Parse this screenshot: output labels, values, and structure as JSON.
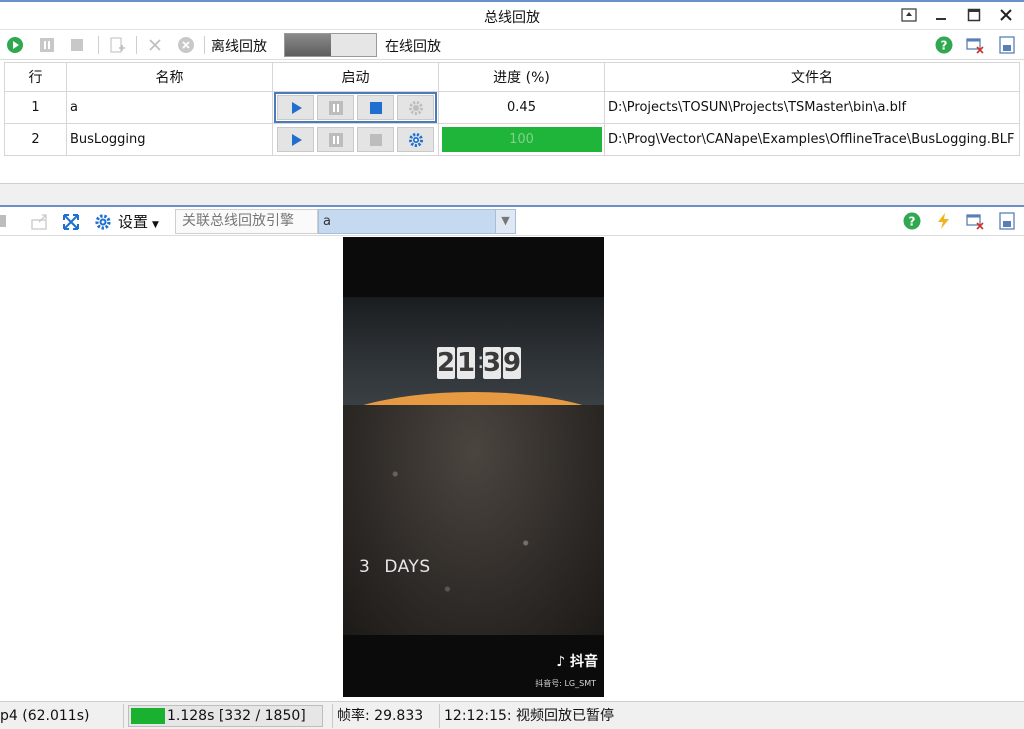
{
  "window": {
    "title": "总线回放"
  },
  "toolbar1": {
    "offline_label": "离线回放",
    "online_label": "在线回放",
    "icons": [
      "play-icon",
      "pause-icon",
      "stop-icon",
      "add-icon",
      "delete-icon",
      "clear-icon",
      "help-icon",
      "close-window-icon",
      "export-icon"
    ]
  },
  "table": {
    "headers": {
      "row": "行",
      "name": "名称",
      "start": "启动",
      "progress": "进度 (%)",
      "file": "文件名"
    },
    "rows": [
      {
        "row": "1",
        "name": "a",
        "progress": "0.45",
        "progress_fraction": 0.0045,
        "file": "D:\\Projects\\TOSUN\\Projects\\TSMaster\\bin\\a.blf",
        "stop_active": true
      },
      {
        "row": "2",
        "name": "BusLogging",
        "progress": "100",
        "progress_fraction": 1.0,
        "file": "D:\\Prog\\Vector\\CANape\\Examples\\OfflineTrace\\BusLogging.BLF",
        "stop_active": false
      }
    ]
  },
  "toolbar2": {
    "settings_label": "设置",
    "engine_label": "关联总线回放引擎",
    "engine_value": "a"
  },
  "video": {
    "clock": {
      "h1": "2",
      "h2": "1",
      "m1": "3",
      "m2": "9"
    },
    "days_number": "3",
    "days_word": "DAYS",
    "logo": "抖音",
    "sub": "抖音号: LG_SMT"
  },
  "status": {
    "file_duration": "p4 (62.011s)",
    "position": "1.128s [332 / 1850]",
    "position_fraction": 0.18,
    "fps": "帧率: 29.833",
    "message": "12:12:15: 视频回放已暂停"
  },
  "colors": {
    "accent": "#6a8fc9",
    "progress_green": "#1fb53a",
    "play_blue": "#1e6fd0",
    "help_green": "#2fa84f"
  }
}
